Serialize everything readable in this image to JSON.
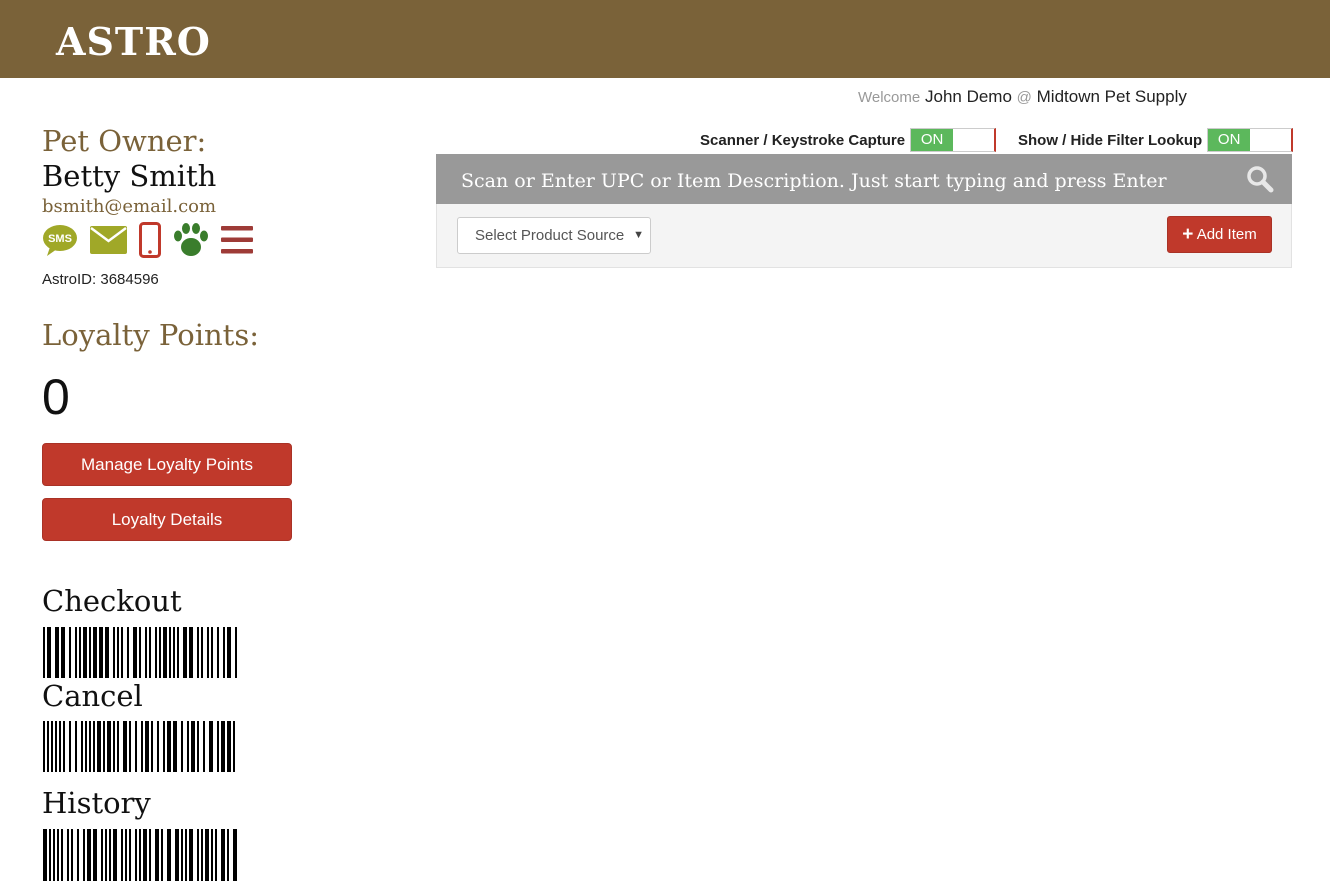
{
  "header": {
    "logo_text": "ASTRO",
    "bar_color": "#7a6239"
  },
  "welcome": {
    "prefix": "Welcome",
    "user": "John Demo",
    "at": "@",
    "store": "Midtown Pet Supply"
  },
  "owner": {
    "label": "Pet Owner:",
    "name": "Betty Smith",
    "email": "bsmith@email.com",
    "astroid_label": "AstroID:",
    "astroid": "3684596",
    "icons": [
      "sms-icon",
      "envelope-icon",
      "mobile-phone-icon",
      "paw-icon",
      "menu-icon"
    ]
  },
  "loyalty": {
    "label": "Loyalty Points:",
    "points": "0",
    "manage_label": "Manage Loyalty Points",
    "details_label": "Loyalty Details"
  },
  "barcodes": [
    {
      "label": "Checkout"
    },
    {
      "label": "Cancel"
    },
    {
      "label": "History"
    }
  ],
  "toggles": [
    {
      "label": "Scanner / Keystroke Capture",
      "state": "ON"
    },
    {
      "label": "Show / Hide Filter Lookup",
      "state": "ON"
    }
  ],
  "search": {
    "placeholder": "Scan or Enter UPC or Item Description. Just start typing and press Enter"
  },
  "product_source": {
    "selected": "Select Product Source"
  },
  "add_item": {
    "icon": "plus-icon",
    "label": "Add Item"
  },
  "colors": {
    "brand_brown": "#7a6239",
    "danger_red": "#c0392b",
    "toggle_green": "#5cb85c",
    "sms_green": "#a0a828",
    "paw_green": "#3a7d2c"
  }
}
